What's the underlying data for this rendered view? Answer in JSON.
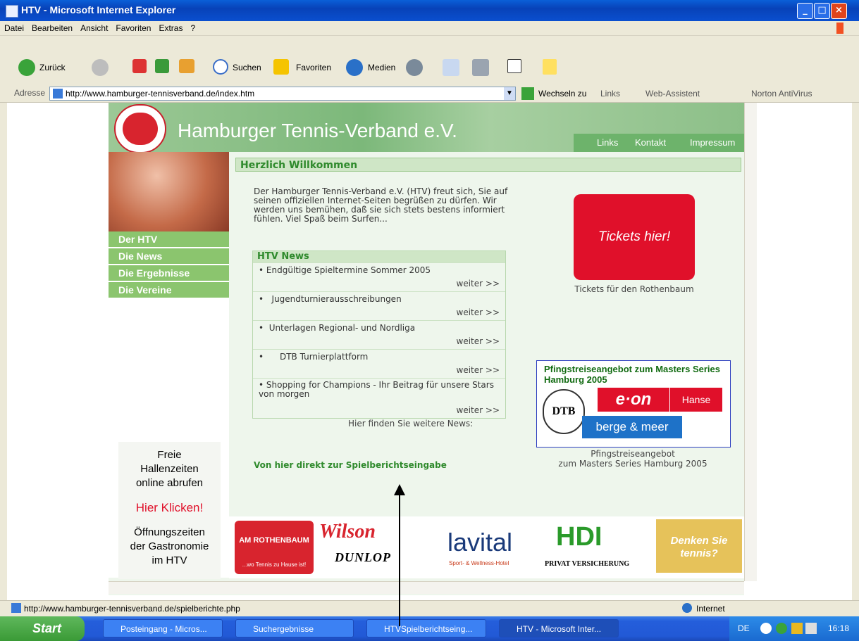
{
  "window": {
    "title": "HTV - Microsoft Internet Explorer"
  },
  "menu": [
    "Datei",
    "Bearbeiten",
    "Ansicht",
    "Favoriten",
    "Extras",
    "?"
  ],
  "toolbar": {
    "back": "Zurück",
    "search": "Suchen",
    "favorites": "Favoriten",
    "media": "Medien"
  },
  "address": {
    "label": "Adresse",
    "url": "http://www.hamburger-tennisverband.de/index.htm",
    "go": "Wechseln zu",
    "links": "Links",
    "assistant": "Web-Assistent",
    "norton": "Norton AntiVirus"
  },
  "site": {
    "title": "Hamburger Tennis-Verband e.V.",
    "topnav": [
      "Links",
      "Kontakt",
      "Impressum"
    ],
    "leftnav": [
      "Der HTV",
      "Die News",
      "Die Ergebnisse",
      "Die Vereine"
    ],
    "hallen": {
      "line1": "Freie",
      "line2": "Hallenzeiten",
      "line3": "online abrufen",
      "cta": "Hier Klicken!",
      "line4": "Öffnungszeiten",
      "line5": "der Gastronomie",
      "line6": "im HTV"
    },
    "welcome": "Herzlich Willkommen",
    "intro": "Der Hamburger Tennis-Verband e.V. (HTV) freut sich, Sie auf seinen offiziellen Internet-Seiten begrüßen zu dürfen. Wir werden uns bemühen, daß sie sich stets bestens informiert fühlen. Viel Spaß beim Surfen...",
    "news_title": "HTV News",
    "news": [
      {
        "title": "Endgültige Spieltermine Sommer 2005",
        "more": "weiter >>"
      },
      {
        "title": "Jugendturnierausschreibungen",
        "more": "weiter >>"
      },
      {
        "title": "Unterlagen Regional- und Nordliga",
        "more": "weiter >>"
      },
      {
        "title": "DTB Turnierplattform",
        "more": "weiter >>"
      },
      {
        "title": "Shopping for Champions - Ihr Beitrag für unsere Stars von morgen",
        "more": "weiter >>"
      }
    ],
    "more_news": "Hier finden Sie weitere News:",
    "spielbericht": "Von hier direkt zur Spielberichtseingabe",
    "tickets": "Tickets hier!",
    "tickets_caption": "Tickets für den Rothenbaum",
    "pfingst_title": "Pfingstreiseangebot zum Masters Series Hamburg 2005",
    "pfingst_eon": "e·on",
    "pfingst_hanse": "Hanse",
    "pfingst_dtb": "DTB",
    "pfingst_berge": "berge & meer",
    "pfingst_caption1": "Pfingstreiseangebot",
    "pfingst_caption2": "zum Masters Series Hamburg 2005",
    "sponsors": {
      "rothenbaum": "AM ROTHENBAUM",
      "rothenbaum_sub": "...wo Tennis zu Hause ist!",
      "wilson": "Wilson",
      "dunlop": "DUNLOP",
      "lavital": "lavital",
      "lavital_sub": "Sport- & Wellness-Hotel",
      "hdi": "HDI",
      "hdi_sub": "PRIVAT VERSICHERUNG",
      "denken1": "Denken Sie",
      "denken2": "tennis?"
    }
  },
  "status": {
    "url": "http://www.hamburger-tennisverband.de/spielberichte.php",
    "zone": "Internet"
  },
  "taskbar": {
    "start": "Start",
    "tasks": [
      "Posteingang - Micros...",
      "Suchergebnisse",
      "HTVSpielberichtseing...",
      "HTV - Microsoft Inter..."
    ],
    "lang": "DE",
    "time": "16:18"
  }
}
